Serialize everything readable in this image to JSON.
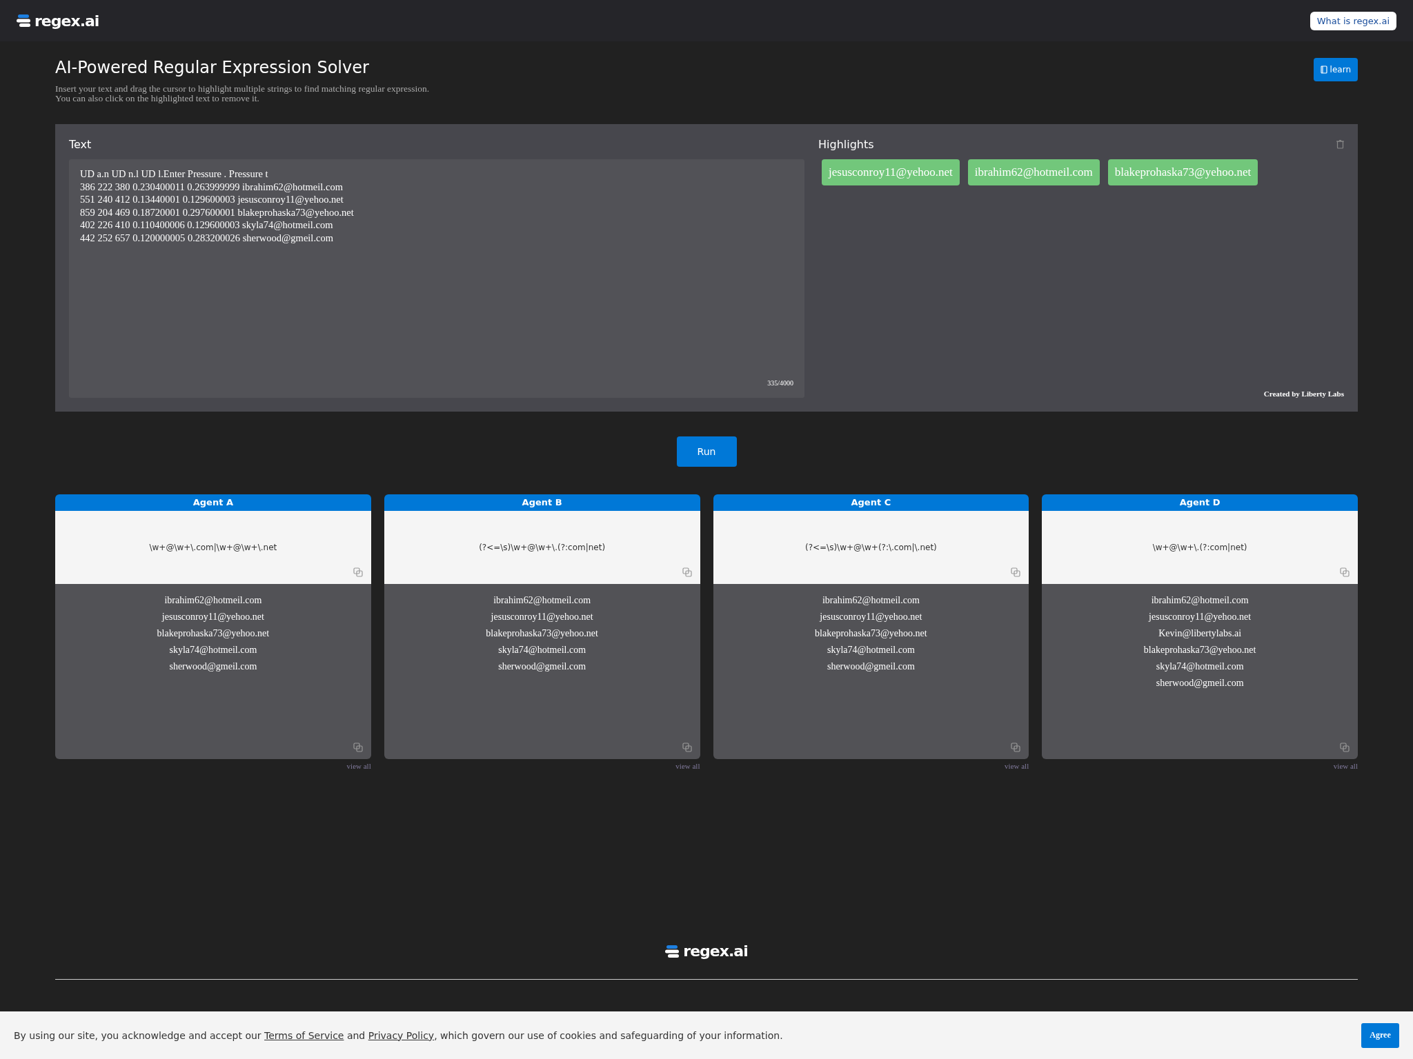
{
  "header": {
    "logo": "regex.ai",
    "about_button": "What is regex.ai"
  },
  "intro": {
    "title": "AI-Powered Regular Expression Solver",
    "lines": [
      "Insert your text and drag the cursor to highlight multiple strings to find matching regular expression.",
      "You can also click on the highlighted text to remove it."
    ],
    "learn_button": "learn"
  },
  "text_panel": {
    "label": "Text",
    "lines": [
      "UD a.n UD n.l UD l.Enter Pressure . Pressure t",
      "386 222 380 0.230400011 0.263999999 ibrahim62@hotmeil.com",
      "551 240 412 0.13440001 0.129600003 jesusconroy11@yehoo.net",
      "859 204 469 0.18720001 0.297600001 blakeprohaska73@yehoo.net",
      "402 226 410 0.110400006 0.129600003 skyla74@hotmeil.com",
      "442 252 657 0.120000005 0.283200026 sherwood@gmeil.com"
    ],
    "char_count": "335/4000"
  },
  "highlights": {
    "label": "Highlights",
    "chips": [
      "jesusconroy11@yehoo.net",
      "ibrahim62@hotmeil.com",
      "blakeprohaska73@yehoo.net"
    ],
    "credit": "Created by Liberty Labs"
  },
  "run_button": "Run",
  "agents": [
    {
      "name": "Agent A",
      "regex": "\\w+@\\w+\\.com|\\w+@\\w+\\.net",
      "matches": [
        "ibrahim62@hotmeil.com",
        "jesusconroy11@yehoo.net",
        "blakeprohaska73@yehoo.net",
        "skyla74@hotmeil.com",
        "sherwood@gmeil.com"
      ],
      "view_all": "view all"
    },
    {
      "name": "Agent B",
      "regex": "(?<=\\s)\\w+@\\w+\\.(?:com|net)",
      "matches": [
        "ibrahim62@hotmeil.com",
        "jesusconroy11@yehoo.net",
        "blakeprohaska73@yehoo.net",
        "skyla74@hotmeil.com",
        "sherwood@gmeil.com"
      ],
      "view_all": "view all"
    },
    {
      "name": "Agent C",
      "regex": "(?<=\\s)\\w+@\\w+(?:\\.com|\\.net)",
      "matches": [
        "ibrahim62@hotmeil.com",
        "jesusconroy11@yehoo.net",
        "blakeprohaska73@yehoo.net",
        "skyla74@hotmeil.com",
        "sherwood@gmeil.com"
      ],
      "view_all": "view all"
    },
    {
      "name": "Agent D",
      "regex": "\\w+@\\w+\\.(?:com|net)",
      "matches": [
        "ibrahim62@hotmeil.com",
        "jesusconroy11@yehoo.net",
        "Kevin@libertylabs.ai",
        "blakeprohaska73@yehoo.net",
        "skyla74@hotmeil.com",
        "sherwood@gmeil.com"
      ],
      "view_all": "view all"
    }
  ],
  "footer": {
    "logo": "regex.ai"
  },
  "cookie_banner": {
    "segments": [
      {
        "kind": "text",
        "text": "By using our site, you acknowledge and accept our "
      },
      {
        "kind": "link",
        "text": "Terms of Service"
      },
      {
        "kind": "text",
        "text": " and "
      },
      {
        "kind": "link",
        "text": "Privacy Policy"
      },
      {
        "kind": "text",
        "text": ", which govern our use of cookies and safeguarding of your information."
      }
    ],
    "agree_button": "Agree"
  }
}
